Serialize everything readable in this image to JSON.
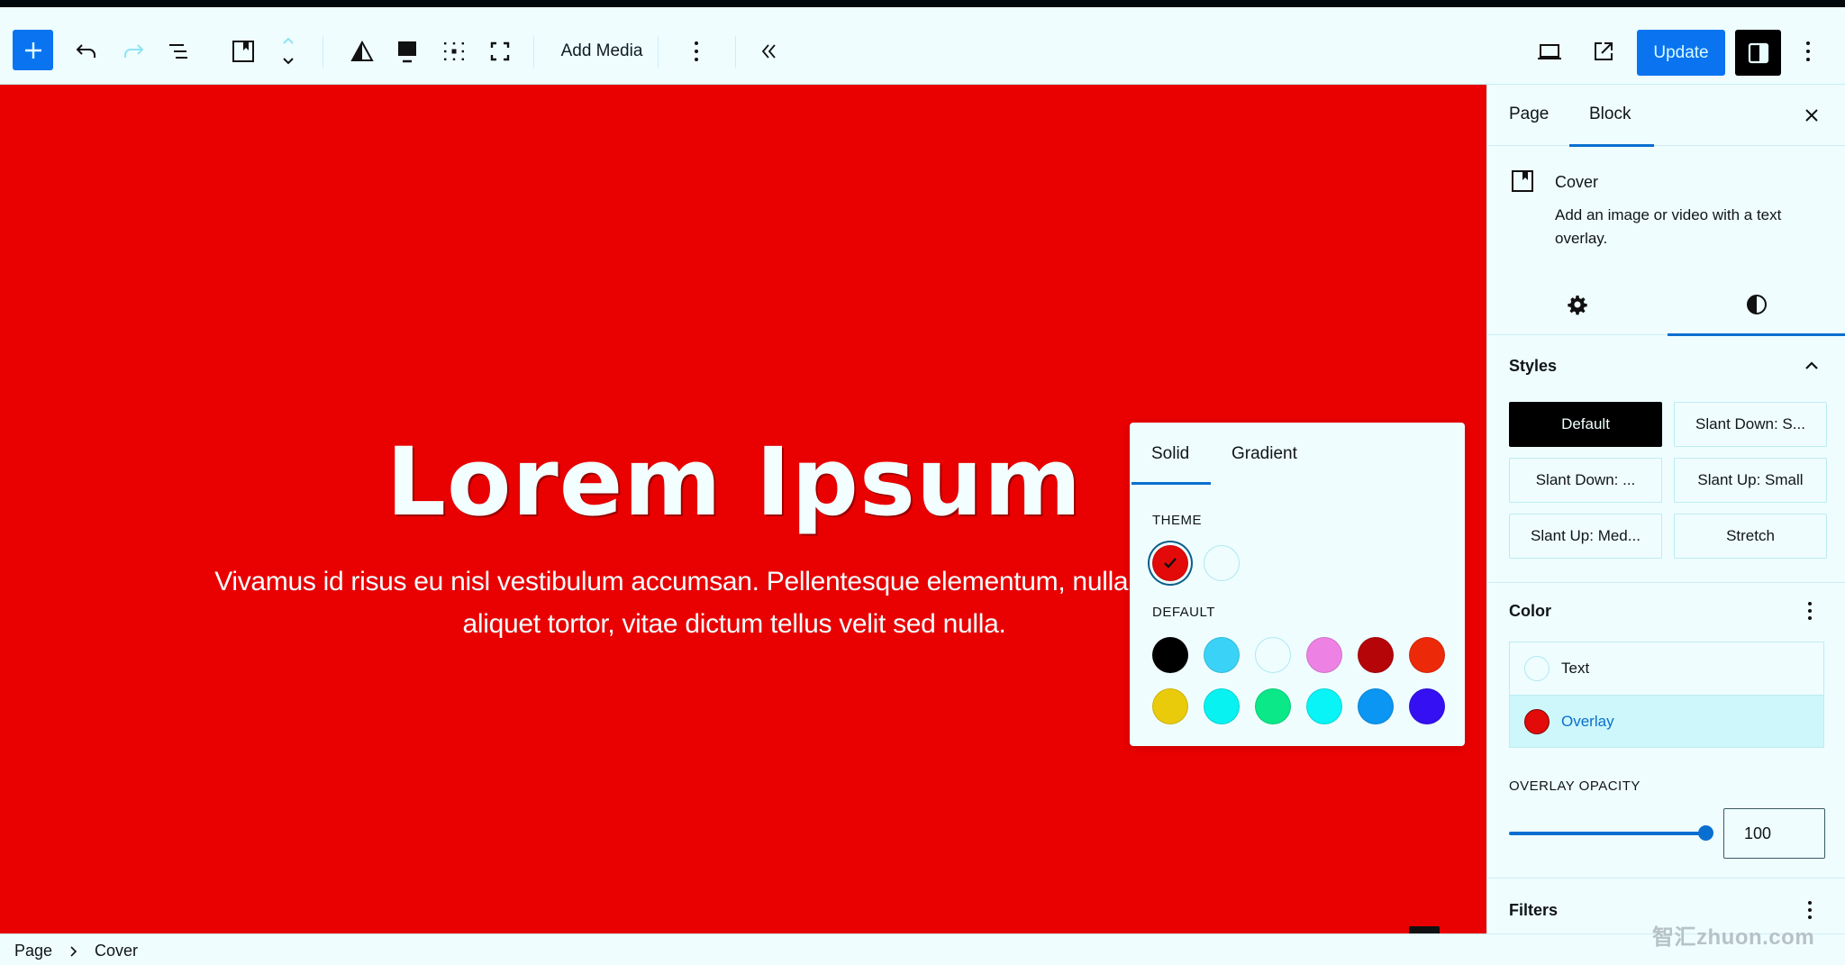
{
  "toolbar": {
    "add_block_icon": "plus-icon",
    "undo_icon": "undo-icon",
    "redo_icon": "redo-icon",
    "document_overview_icon": "list-view-icon",
    "block_type_icon": "cover-block-icon",
    "move_icon": "move-up-down-icon",
    "contrast_icon": "contrast-triangle-icon",
    "content_position_icon": "content-position-icon",
    "grid_icon": "grid-dots-icon",
    "fullheight_icon": "fullscreen-icon",
    "add_media_label": "Add Media",
    "more_icon": "more-vertical-icon",
    "collapse_icon": "chevron-double-left-icon",
    "view_icon": "desktop-view-icon",
    "external_icon": "external-link-icon",
    "update_label": "Update",
    "settings_icon": "sidebar-toggle-icon",
    "options_icon": "more-vertical-icon"
  },
  "canvas": {
    "background_color": "#e90000",
    "title": "Lorem Ipsum",
    "body_line1": "Vivamus id risus eu nisl vestibulum accumsan. Pellentesque elementum, nulla ac fringilla",
    "body_line2": "aliquet tortor, vitae dictum tellus velit sed nulla."
  },
  "color_popover": {
    "tabs": [
      "Solid",
      "Gradient"
    ],
    "active_tab": "Solid",
    "theme_label": "THEME",
    "theme_colors": [
      {
        "name": "red",
        "hex": "#e30a0a",
        "selected": true
      },
      {
        "name": "white",
        "hex": "#effdff",
        "selected": false
      }
    ],
    "default_label": "DEFAULT",
    "default_colors": [
      {
        "name": "black",
        "hex": "#000000"
      },
      {
        "name": "cyan-bluish-gray",
        "hex": "#3ad3f7"
      },
      {
        "name": "white",
        "hex": "#effdff"
      },
      {
        "name": "pale-pink",
        "hex": "#ee82e4"
      },
      {
        "name": "vivid-red",
        "hex": "#b50508"
      },
      {
        "name": "luminous-vivid-orange",
        "hex": "#ec2a0a"
      },
      {
        "name": "luminous-vivid-amber",
        "hex": "#eacb0c"
      },
      {
        "name": "light-green-cyan",
        "hex": "#08f2f2"
      },
      {
        "name": "vivid-green-cyan",
        "hex": "#0ae888"
      },
      {
        "name": "pale-cyan-blue",
        "hex": "#08f4f7"
      },
      {
        "name": "vivid-cyan-blue",
        "hex": "#0a96f2"
      },
      {
        "name": "vivid-purple",
        "hex": "#3510f2"
      }
    ]
  },
  "sidebar": {
    "tabs": [
      "Page",
      "Block"
    ],
    "active_tab": "Block",
    "close_icon": "close-icon",
    "block": {
      "name": "Cover",
      "description": "Add an image or video with a text overlay."
    },
    "sub_tabs": [
      {
        "icon": "gear-icon",
        "label": "Settings"
      },
      {
        "icon": "contrast-icon",
        "label": "Styles",
        "active": true
      }
    ],
    "styles": {
      "title": "Styles",
      "options": [
        "Default",
        "Slant Down: S...",
        "Slant Down: ...",
        "Slant Up: Small",
        "Slant Up: Med...",
        "Stretch"
      ],
      "active": "Default"
    },
    "color": {
      "title": "Color",
      "items": [
        {
          "label": "Text",
          "hex": "#effdff",
          "active": false
        },
        {
          "label": "Overlay",
          "hex": "#e30a0a",
          "active": true
        }
      ]
    },
    "overlay_opacity": {
      "label": "OVERLAY OPACITY",
      "value": "100",
      "percent": 100
    },
    "filters": {
      "title": "Filters"
    }
  },
  "statusbar": {
    "breadcrumb": [
      "Page",
      "Cover"
    ]
  },
  "watermark": "智汇zhuon.com",
  "colors": {
    "accent": "#0a74f0",
    "tab_underline": "#0a6fd0"
  }
}
